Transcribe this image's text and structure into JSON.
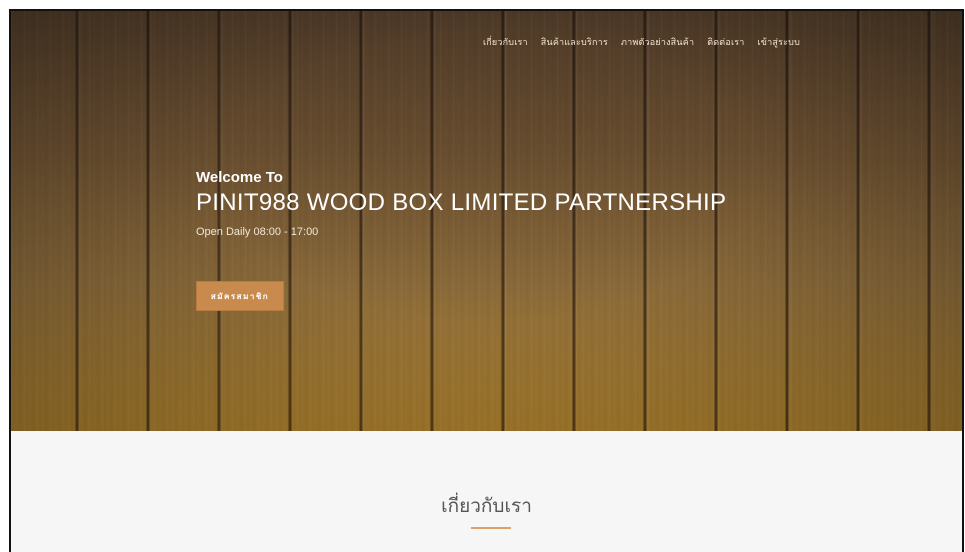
{
  "nav": {
    "items": [
      {
        "label": "เกี่ยวกับเรา"
      },
      {
        "label": "สินค้าและบริการ"
      },
      {
        "label": "ภาพตัวอย่างสินค้า"
      },
      {
        "label": "ติดต่อเรา"
      },
      {
        "label": "เข้าสู่ระบบ"
      }
    ]
  },
  "hero": {
    "welcome": "Welcome To",
    "company": "PINIT988 WOOD BOX LIMITED PARTNERSHIP",
    "hours": "Open Daily 08:00 - 17:00",
    "cta_label": "สมัครสมาชิก"
  },
  "about": {
    "title": "เกี่ยวกับเรา"
  },
  "colors": {
    "accent": "#c98a4d",
    "underline": "#d9a06a",
    "section_bg": "#f6f6f6"
  }
}
